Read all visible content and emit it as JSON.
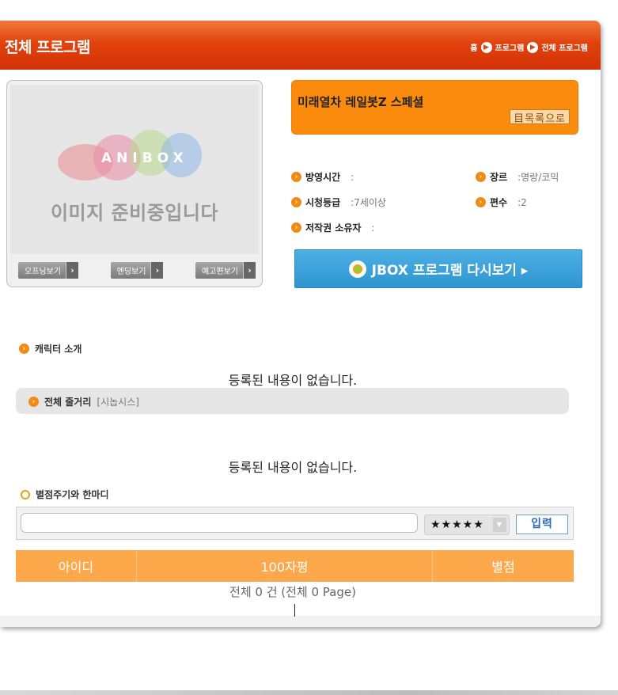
{
  "header": {
    "title": "전체 프로그램",
    "breadcrumb": [
      "홈",
      "프로그램",
      "전체 프로그램"
    ]
  },
  "poster": {
    "logo_text": "ANIBOX",
    "placeholder_text": "이미지 준비중입니다",
    "buttons": [
      "오프닝보기",
      "엔딩보기",
      "예고편보기"
    ]
  },
  "program": {
    "title": "미래열차 레일봇Z 스페셜",
    "list_button": "目목록으로",
    "info": {
      "air_time_label": "방영시간",
      "air_time_value": ":",
      "genre_label": "장르",
      "genre_value": ":명랑/코믹",
      "rating_label": "시청등급",
      "rating_value": ":7세이상",
      "episodes_label": "편수",
      "episodes_value": ":2",
      "copyright_label": "저작권 소유자",
      "copyright_value": ":"
    },
    "jbox_button": "JBOX 프로그램 다시보기 ▸"
  },
  "sections": {
    "character_label": "캐릭터 소개",
    "character_empty": "등록된 내용이 없습니다.",
    "synopsis_label": "전체 줄거리",
    "synopsis_sub": "[시놉시스]",
    "synopsis_empty": "등록된 내용이 없습니다."
  },
  "comment": {
    "label": "별점주기와 한마디",
    "input_value": "",
    "star_value": "★★★★★",
    "submit_label": "입력"
  },
  "table": {
    "headers": [
      "아이디",
      "100자평",
      "별점"
    ],
    "total_text": "전체 0 건 (전체 0 Page)"
  },
  "colors": {
    "header": "#e2420c",
    "orange": "#fb8b0c",
    "jbox": "#3aa2db",
    "table_head": "#fda84b"
  }
}
